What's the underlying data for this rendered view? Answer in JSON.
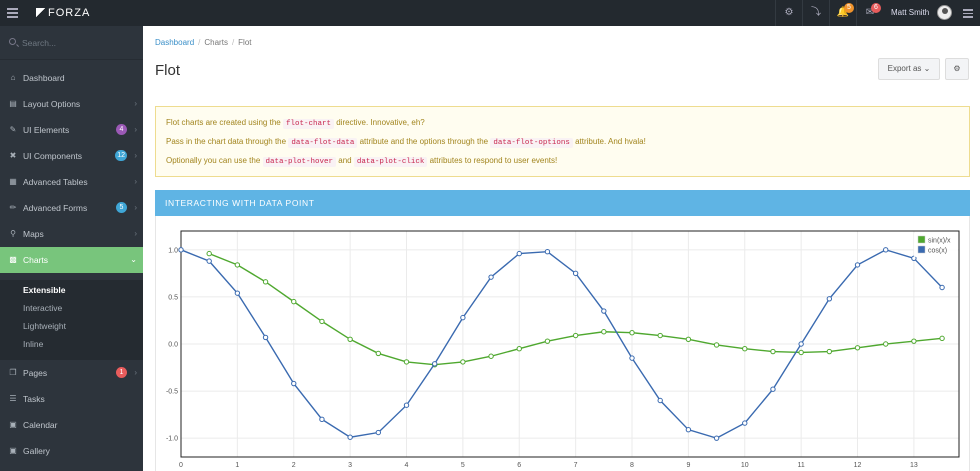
{
  "topbar": {
    "brand": "FORZA",
    "icons": [
      "gear-icon",
      "pin-icon",
      "bell-icon",
      "mail-icon"
    ],
    "notifications_count": "5",
    "messages_count": "6",
    "user_name": "Matt Smith",
    "badge_colors": {
      "notifications": "#f0932b",
      "messages": "#e85c5c"
    }
  },
  "sidebar": {
    "search_placeholder": "Search...",
    "items": [
      {
        "label": "Dashboard",
        "icon": "home-icon"
      },
      {
        "label": "Layout Options",
        "icon": "layout-icon"
      },
      {
        "label": "UI Elements",
        "icon": "brush-icon",
        "badge": "4",
        "badge_color": "#9b59b6"
      },
      {
        "label": "UI Components",
        "icon": "puzzle-icon",
        "badge": "12",
        "badge_color": "#3fa6d6"
      },
      {
        "label": "Advanced Tables",
        "icon": "table-icon"
      },
      {
        "label": "Advanced Forms",
        "icon": "pencil-icon",
        "badge": "5",
        "badge_color": "#3fa6d6"
      },
      {
        "label": "Maps",
        "icon": "map-pin-icon"
      },
      {
        "label": "Charts",
        "icon": "chart-icon"
      },
      {
        "label": "Pages",
        "icon": "pages-icon",
        "badge": "1",
        "badge_color": "#e85c5c"
      },
      {
        "label": "Tasks",
        "icon": "tasks-icon"
      },
      {
        "label": "Calendar",
        "icon": "calendar-icon"
      },
      {
        "label": "Gallery",
        "icon": "gallery-icon"
      }
    ],
    "sub_items": [
      "Extensible",
      "Interactive",
      "Lightweight",
      "Inline"
    ]
  },
  "main": {
    "breadcrumb": [
      "Dashboard",
      "Charts",
      "Flot"
    ],
    "title": "Flot",
    "export_label": "Export as",
    "alert": {
      "line1_a": "Flot charts are created using the",
      "line1_code": "flot-chart",
      "line1_b": "directive. Innovative, eh?",
      "line2_a": "Pass in the chart data through the",
      "line2_code1": "data-flot-data",
      "line2_b": "attribute and the options through the",
      "line2_code2": "data-flot-options",
      "line2_c": "attribute. And hvala!",
      "line3_a": "Optionally you can use the",
      "line3_code1": "data-plot-hover",
      "line3_b": "and",
      "line3_code2": "data-plot-click",
      "line3_c": "attributes to respond to user events!"
    },
    "panel_title": "INTERACTING WITH DATA POINT"
  },
  "chart_data": {
    "type": "line",
    "xlim": [
      0,
      13.8
    ],
    "ylim": [
      -1.2,
      1.2
    ],
    "x_ticks": [
      0,
      1,
      2,
      3,
      4,
      5,
      6,
      7,
      8,
      9,
      10,
      11,
      12,
      13
    ],
    "y_ticks": [
      1.0,
      0.5,
      0.0,
      -0.5,
      -1.0
    ],
    "y_tick_labels": [
      "1.0",
      "0.5",
      "0.0",
      "-0.5",
      "-1.0"
    ],
    "grid": true,
    "legend_position": "top-right",
    "series": [
      {
        "name": "sin(x)/x",
        "color": "#4fa82f",
        "x": [
          0.5,
          1.0,
          1.5,
          2.0,
          2.5,
          3.0,
          3.5,
          4.0,
          4.5,
          5.0,
          5.5,
          6.0,
          6.5,
          7.0,
          7.5,
          8.0,
          8.5,
          9.0,
          9.5,
          10.0,
          10.5,
          11.0,
          11.5,
          12.0,
          12.5,
          13.0,
          13.5
        ],
        "y": [
          0.96,
          0.84,
          0.66,
          0.45,
          0.24,
          0.05,
          -0.1,
          -0.19,
          -0.22,
          -0.19,
          -0.13,
          -0.05,
          0.03,
          0.09,
          0.13,
          0.12,
          0.09,
          0.05,
          -0.01,
          -0.05,
          -0.08,
          -0.09,
          -0.08,
          -0.04,
          0.0,
          0.03,
          0.06
        ]
      },
      {
        "name": "cos(x)",
        "color": "#3a6ab0",
        "x": [
          0.0,
          0.5,
          1.0,
          1.5,
          2.0,
          2.5,
          3.0,
          3.5,
          4.0,
          4.5,
          5.0,
          5.5,
          6.0,
          6.5,
          7.0,
          7.5,
          8.0,
          8.5,
          9.0,
          9.5,
          10.0,
          10.5,
          11.0,
          11.5,
          12.0,
          12.5,
          13.0,
          13.5
        ],
        "y": [
          1.0,
          0.88,
          0.54,
          0.07,
          -0.42,
          -0.8,
          -0.99,
          -0.94,
          -0.65,
          -0.21,
          0.28,
          0.71,
          0.96,
          0.98,
          0.75,
          0.35,
          -0.15,
          -0.6,
          -0.91,
          -1.0,
          -0.84,
          -0.48,
          0.0,
          0.48,
          0.84,
          1.0,
          0.91,
          0.6
        ]
      }
    ]
  }
}
